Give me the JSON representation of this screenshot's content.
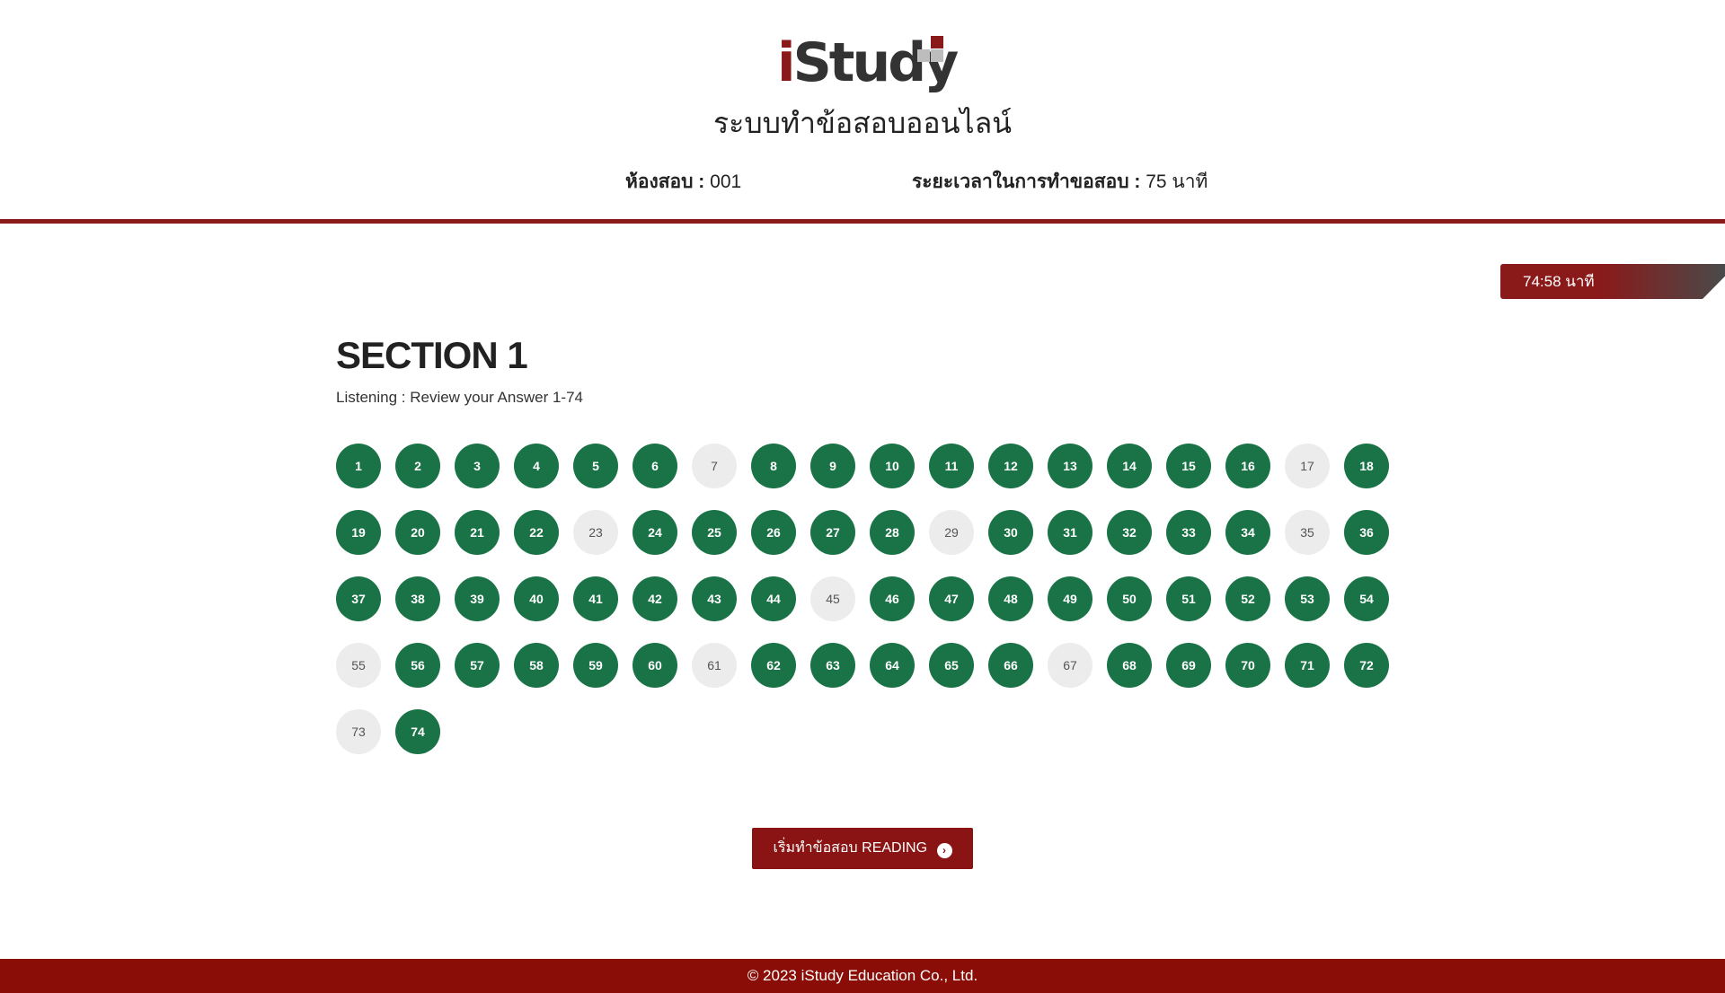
{
  "header": {
    "logo_text": "iStudy",
    "system_title": "ระบบทำข้อสอบออนไลน์",
    "room_label": "ห้องสอบ :",
    "room_value": "001",
    "duration_label": "ระยะเวลาในการทำขอสอบ :",
    "duration_value": "75 นาที"
  },
  "timer": {
    "text": "74:58 นาที"
  },
  "section": {
    "title": "SECTION 1",
    "subtitle": "Listening : Review your Answer 1-74"
  },
  "questions": {
    "total": 74,
    "unanswered": [
      7,
      17,
      23,
      29,
      35,
      45,
      55,
      61,
      67,
      73
    ],
    "colors": {
      "answered": "#1a7347",
      "unanswered": "#ececec"
    }
  },
  "start_button": {
    "label": "เริ่มทำข้อสอบ READING",
    "icon": "chevron-right-circle-icon"
  },
  "footer": {
    "copyright": "© 2023 iStudy Education Co., Ltd."
  },
  "theme": {
    "brand_red": "#8a1a1a",
    "footer_red": "#8a0e07"
  }
}
